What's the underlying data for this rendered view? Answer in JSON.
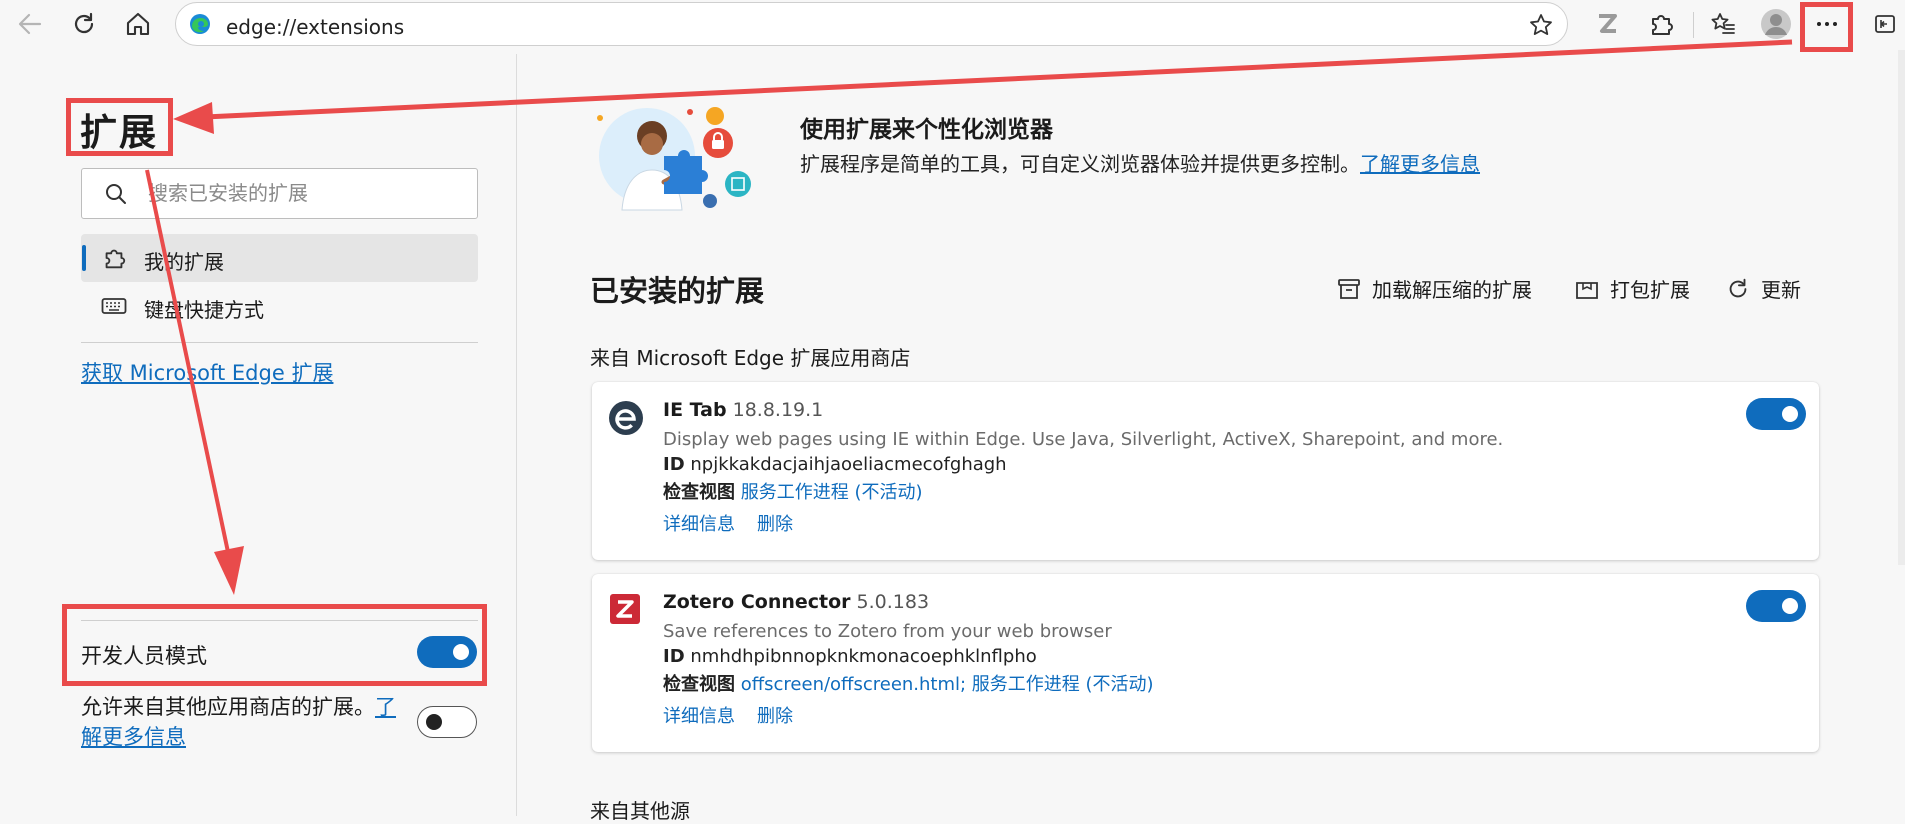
{
  "toolbar": {
    "url": "edge://extensions"
  },
  "sidebar": {
    "title": "扩展",
    "search_placeholder": "搜索已安装的扩展",
    "nav": [
      {
        "label": "我的扩展"
      },
      {
        "label": "键盘快捷方式"
      }
    ],
    "get_extensions_link": "获取 Microsoft Edge 扩展",
    "developer_mode_label": "开发人员模式",
    "developer_mode_on": true,
    "allow_other_stores_text": "允许来自其他应用商店的扩展。",
    "allow_other_stores_link": "了解更多信息",
    "allow_other_stores_on": false
  },
  "main": {
    "banner_title": "使用扩展来个性化浏览器",
    "banner_desc": "扩展程序是简单的工具，可自定义浏览器体验并提供更多控制。",
    "banner_link": "了解更多信息",
    "installed_title": "已安装的扩展",
    "actions": {
      "load_unpacked": "加载解压缩的扩展",
      "pack": "打包扩展",
      "update": "更新"
    },
    "source_store": "来自 Microsoft Edge 扩展应用商店",
    "source_other": "来自其他源",
    "extensions": [
      {
        "name": "IE Tab",
        "version": "18.8.19.1",
        "description": "Display web pages using IE within Edge. Use Java, Silverlight, ActiveX, Sharepoint, and more.",
        "id_label": "ID",
        "id": "npjkkakdacjaihjaoeliacmecofghagh",
        "inspect_label": "检查视图",
        "inspect_views": "服务工作进程 (不活动)",
        "details": "详细信息",
        "remove": "删除",
        "enabled": true
      },
      {
        "name": "Zotero Connector",
        "version": "5.0.183",
        "description": "Save references to Zotero from your web browser",
        "id_label": "ID",
        "id": "nmhdhpibnnopknkmonacoephklnflpho",
        "inspect_label": "检查视图",
        "inspect_views": "offscreen/offscreen.html; 服务工作进程 (不活动)",
        "details": "详细信息",
        "remove": "删除",
        "enabled": true
      }
    ]
  },
  "colors": {
    "accent": "#0f6cbd",
    "annotation": "#e94b4b"
  }
}
